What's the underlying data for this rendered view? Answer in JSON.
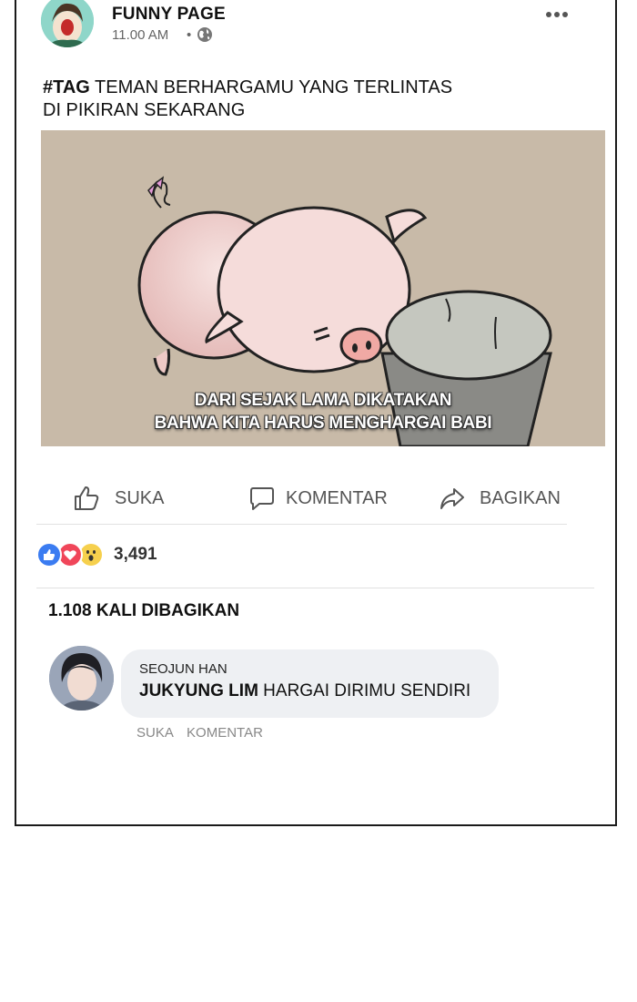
{
  "post": {
    "page_name": "FUNNY PAGE",
    "time": "11.00 AM",
    "separator": "•",
    "caption_tag": "#TAG",
    "caption_line1": " TEMAN BERHARGAMU YANG TERLINTAS",
    "caption_line2": "DI PIKIRAN SEKARANG",
    "image": {
      "subtitle_line1": "DARI SEJAK LAMA DIKATAKAN",
      "subtitle_line2": "BAHWA KITA HARUS MENGHARGAI BABI"
    }
  },
  "actions": {
    "like_label": "SUKA",
    "comment_label": "KOMENTAR",
    "share_label": "BAGIKAN"
  },
  "stats": {
    "reaction_count": "3,491",
    "shares_text": "1.108 KALI DIBAGIKAN"
  },
  "comment": {
    "author": "SEOJUN HAN",
    "mention": "JUKYUNG LIM",
    "text": " HARGAI DIRIMU SENDIRI",
    "like_link": "SUKA",
    "reply_link": "KOMENTAR"
  },
  "colors": {
    "like_blue": "#3b7cf1",
    "love_red": "#f0465a",
    "wow_yellow": "#f6d04d",
    "bubble_bg": "#eef0f3"
  }
}
